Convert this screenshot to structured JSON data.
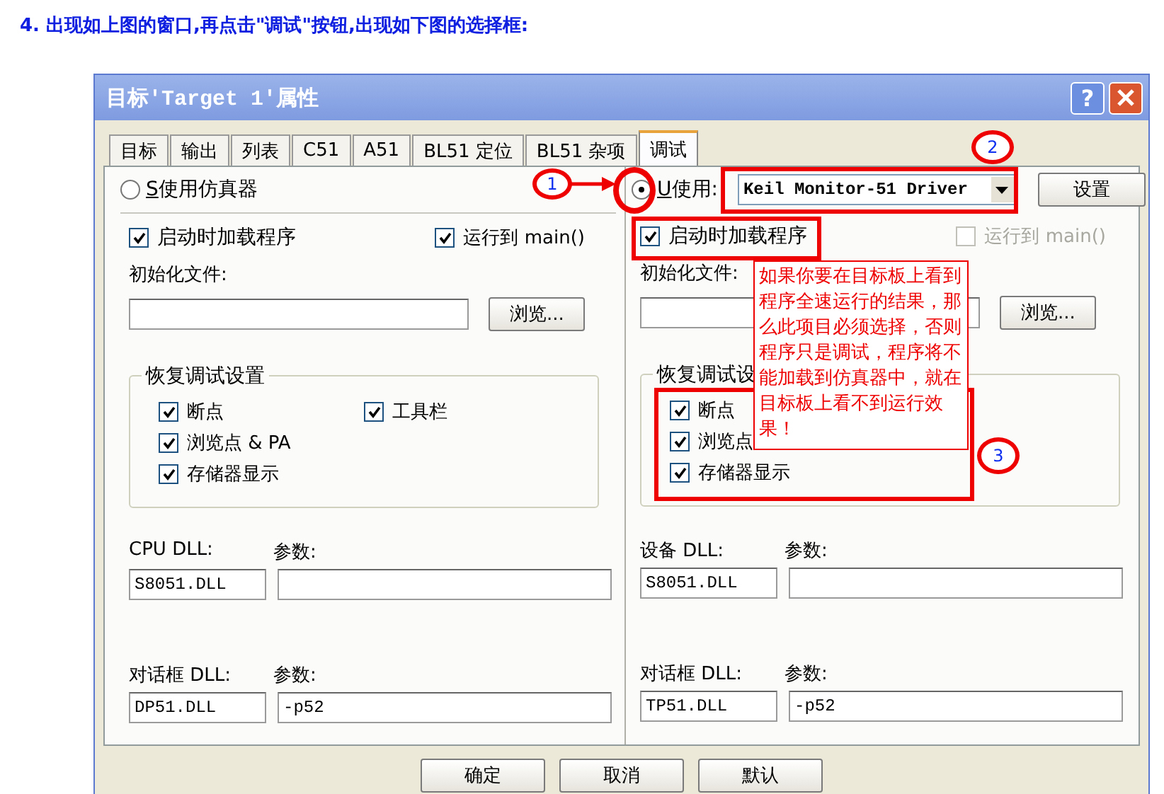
{
  "heading": "4. 出现如上图的窗口,再点击\"调试\"按钮,出现如下图的选择框:",
  "window": {
    "title": "目标'Target 1'属性",
    "help": "?"
  },
  "tabs": [
    {
      "label": "目标",
      "selected": false
    },
    {
      "label": "输出",
      "selected": false
    },
    {
      "label": "列表",
      "selected": false
    },
    {
      "label": "C51",
      "selected": false
    },
    {
      "label": "A51",
      "selected": false
    },
    {
      "label": "BL51 定位",
      "selected": false
    },
    {
      "label": "BL51 杂项",
      "selected": false
    },
    {
      "label": "调试",
      "selected": true
    }
  ],
  "panels": [
    {
      "mode": {
        "hotkey": "S",
        "label": "使用仿真器",
        "selected": false
      },
      "load": {
        "label": "启动时加载程序",
        "checked": true
      },
      "run_main": {
        "label": "运行到 main()",
        "checked": true,
        "disabled": false
      },
      "init_label": "初始化文件:",
      "browse": "浏览...",
      "restore": {
        "title": "恢复调试设置",
        "items": [
          {
            "label": "断点",
            "checked": true
          },
          {
            "label": "浏览点 & PA",
            "checked": true
          },
          {
            "label": "存储器显示",
            "checked": true
          },
          {
            "label": "工具栏",
            "checked": true
          }
        ]
      },
      "dll": [
        {
          "label": "CPU DLL:",
          "value": "S8051.DLL",
          "param_label": "参数:"
        },
        {
          "label": "对话框 DLL:",
          "value": "DP51.DLL",
          "param_label": "参数:",
          "param_value": "-p52"
        }
      ]
    },
    {
      "mode": {
        "hotkey": "U",
        "label": "使用:",
        "selected": true
      },
      "driver": "Keil Monitor-51 Driver",
      "settings": "设置",
      "load": {
        "label": "启动时加载程序",
        "checked": true
      },
      "run_main": {
        "label": "运行到 main()",
        "checked": false,
        "disabled": true
      },
      "init_label": "初始化文件:",
      "browse": "浏览...",
      "restore": {
        "title": "恢复调试设",
        "items": [
          {
            "label": "断点",
            "checked": true
          },
          {
            "label": "浏览点",
            "checked": true
          },
          {
            "label": "存储器显示",
            "checked": true
          }
        ]
      },
      "dll": [
        {
          "label": "设备 DLL:",
          "value": "S8051.DLL",
          "param_label": "参数:"
        },
        {
          "label": "对话框 DLL:",
          "value": "TP51.DLL",
          "param_label": "参数:",
          "param_value": "-p52"
        }
      ]
    }
  ],
  "buttons": [
    "确定",
    "取消",
    "默认"
  ],
  "annotations": {
    "markers": [
      "1",
      "2",
      "3"
    ],
    "callout": "如果你要在目标板上看到程序全速运行的结果，那么此项目必须选择，否则程序只是调试，程序将不能加载到仿真器中，就在目标板上看不到运行效果！"
  }
}
